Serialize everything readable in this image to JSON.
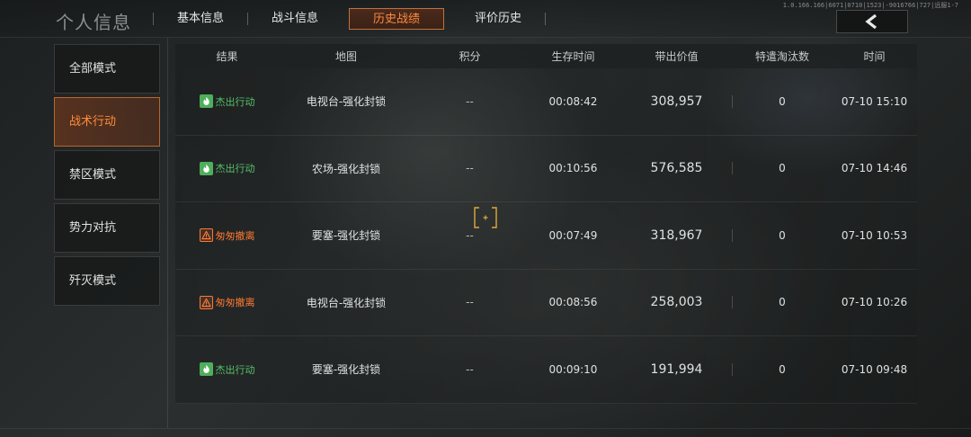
{
  "header": {
    "title": "个人信息",
    "tabs": [
      {
        "label": "基本信息",
        "active": false
      },
      {
        "label": "战斗信息",
        "active": false
      },
      {
        "label": "历史战绩",
        "active": true
      },
      {
        "label": "评价历史",
        "active": false
      }
    ],
    "server_info": "1.0.166.166|6071|0710|1523|-9016766|727|远服1-7",
    "back_icon": "chevron-left-icon"
  },
  "sidebar": {
    "items": [
      {
        "label": "全部模式",
        "active": false
      },
      {
        "label": "战术行动",
        "active": true
      },
      {
        "label": "禁区模式",
        "active": false
      },
      {
        "label": "势力对抗",
        "active": false
      },
      {
        "label": "歼灭模式",
        "active": false
      }
    ]
  },
  "table": {
    "columns": [
      "结果",
      "地图",
      "积分",
      "生存时间",
      "带出价值",
      "特遣淘汰数",
      "时间"
    ],
    "rows": [
      {
        "result": "杰出行动",
        "status": "success",
        "map": "电视台-强化封锁",
        "score": "--",
        "survival": "00:08:42",
        "value": "308,957",
        "kills": "0",
        "time": "07-10 15:10"
      },
      {
        "result": "杰出行动",
        "status": "success",
        "map": "农场-强化封锁",
        "score": "--",
        "survival": "00:10:56",
        "value": "576,585",
        "kills": "0",
        "time": "07-10 14:46"
      },
      {
        "result": "匆匆撤离",
        "status": "fail",
        "map": "要塞-强化封锁",
        "score": "--",
        "survival": "00:07:49",
        "value": "318,967",
        "kills": "0",
        "time": "07-10 10:53"
      },
      {
        "result": "匆匆撤离",
        "status": "fail",
        "map": "电视台-强化封锁",
        "score": "--",
        "survival": "00:08:56",
        "value": "258,003",
        "kills": "0",
        "time": "07-10 10:26"
      },
      {
        "result": "杰出行动",
        "status": "success",
        "map": "要塞-强化封锁",
        "score": "--",
        "survival": "00:09:10",
        "value": "191,994",
        "kills": "0",
        "time": "07-10 09:48"
      }
    ]
  },
  "colors": {
    "accent": "#ff8a3c",
    "success": "#55c26a",
    "fail": "#ff7a34",
    "crosshair": "#e0a93a"
  }
}
